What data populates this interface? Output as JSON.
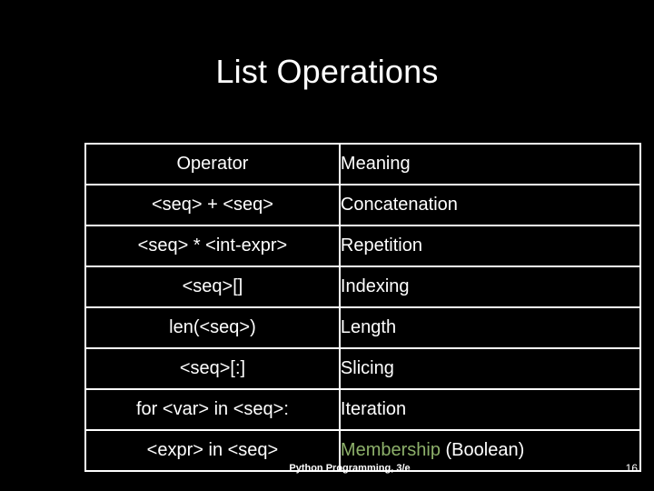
{
  "slide": {
    "title": "List Operations",
    "background_color": "#000000",
    "text_color": "#ffffff",
    "accent_color": "#8db06a"
  },
  "table": {
    "headers": {
      "operator": "Operator",
      "meaning": "Meaning"
    },
    "rows": [
      {
        "operator": "<seq> + <seq>",
        "meaning": "Concatenation",
        "meaning_accent": "",
        "meaning_rest": ""
      },
      {
        "operator": "<seq> * <int-expr>",
        "meaning": "Repetition",
        "meaning_accent": "",
        "meaning_rest": ""
      },
      {
        "operator": "<seq>[]",
        "meaning": "Indexing",
        "meaning_accent": "",
        "meaning_rest": ""
      },
      {
        "operator": "len(<seq>)",
        "meaning": "Length",
        "meaning_accent": "",
        "meaning_rest": ""
      },
      {
        "operator": "<seq>[:]",
        "meaning": "Slicing",
        "meaning_accent": "",
        "meaning_rest": ""
      },
      {
        "operator": "for <var> in <seq>:",
        "meaning": "Iteration",
        "meaning_accent": "",
        "meaning_rest": ""
      },
      {
        "operator": "<expr> in <seq>",
        "meaning": "Membership (Boolean)",
        "meaning_accent": "Membership",
        "meaning_rest": " (Boolean)"
      }
    ]
  },
  "footer": {
    "source": "Python Programming, 3/e",
    "page_number": "16"
  }
}
